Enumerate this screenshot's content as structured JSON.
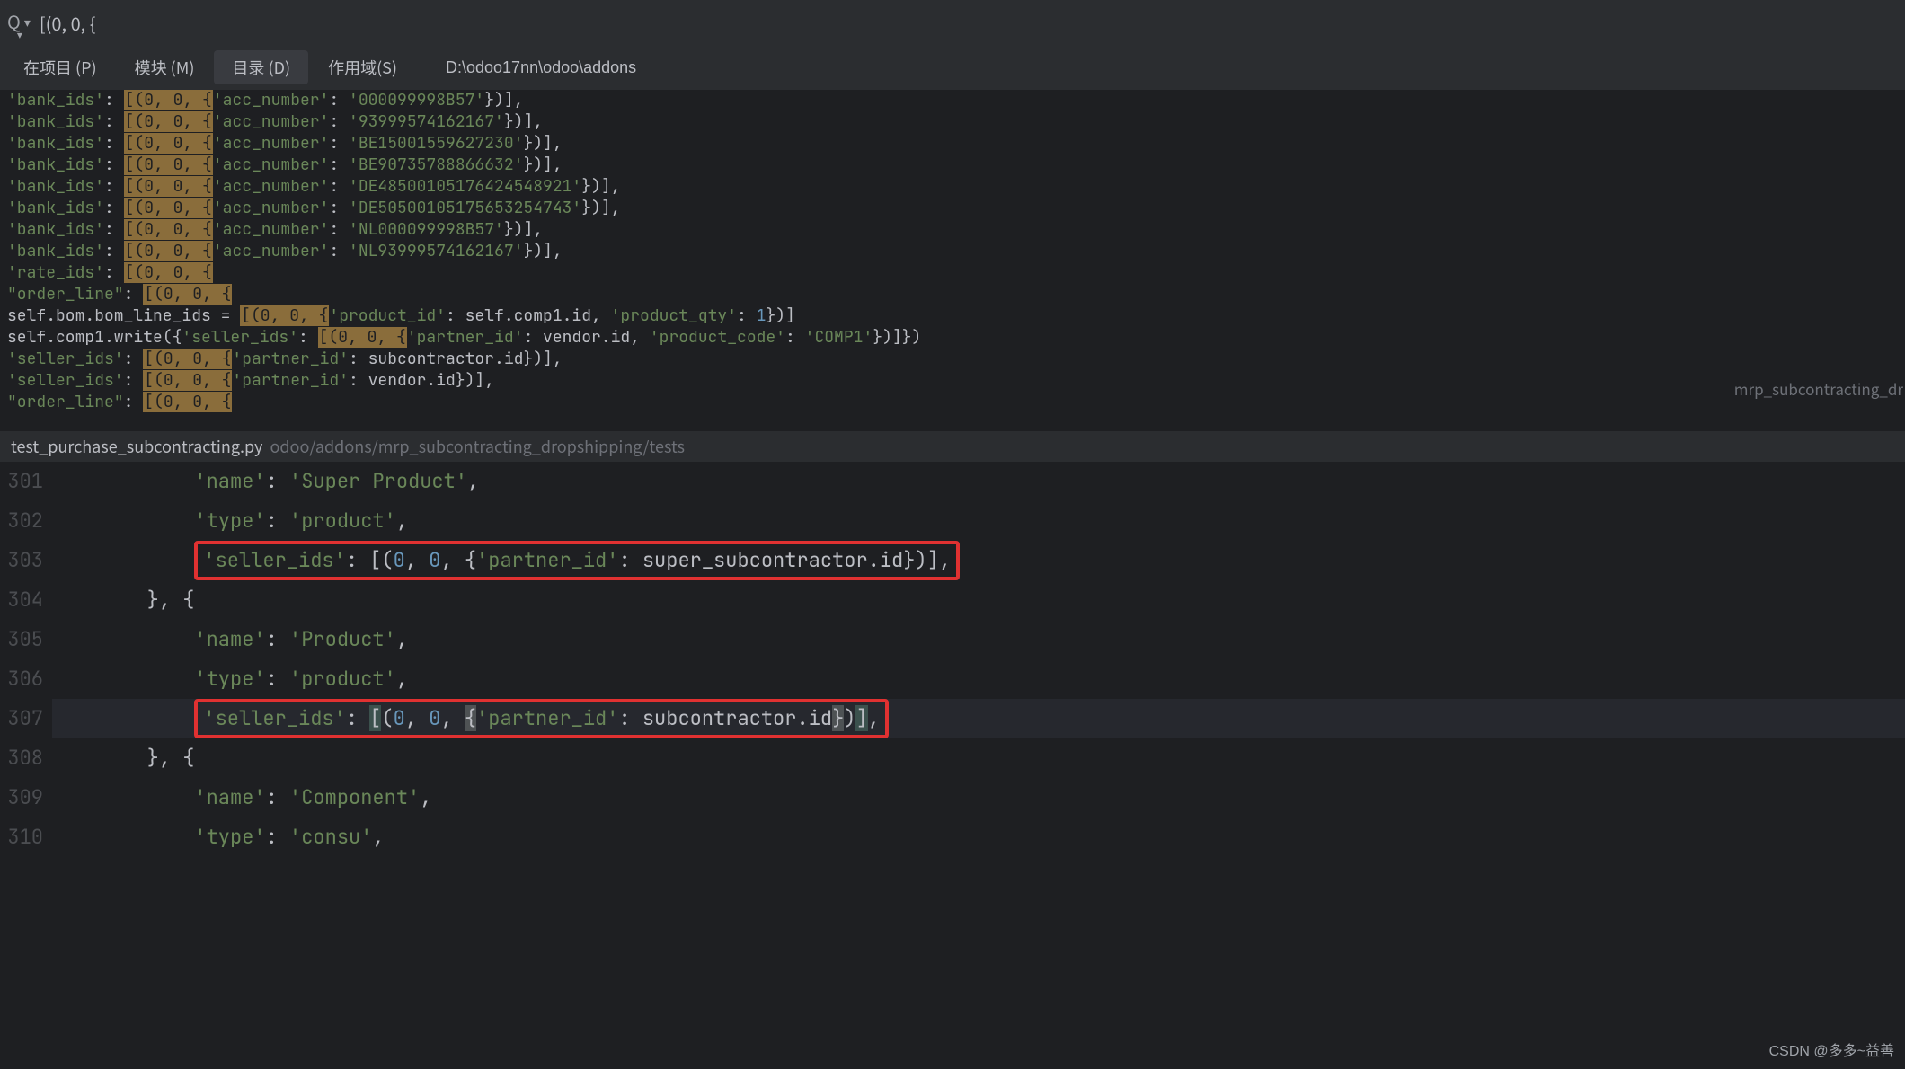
{
  "search": {
    "query": "[(0, 0, {"
  },
  "scopes": {
    "tabs": [
      {
        "label": "在项目 (",
        "key": "P",
        "suffix": ")"
      },
      {
        "label": "模块 (",
        "key": "M",
        "suffix": ")"
      },
      {
        "label": "目录 (",
        "key": "D",
        "suffix": ")"
      },
      {
        "label": "作用域(",
        "key": "S",
        "suffix": ")"
      }
    ],
    "activeIndex": 2,
    "path": "D:\\odoo17nn\\odoo\\addons"
  },
  "results": {
    "hint": "mrp_subcontracting_dr",
    "rows": [
      {
        "pre": "'bank_ids': ",
        "hl": "[(0, 0, {",
        "post": "'acc_number': '000099998B57'})],"
      },
      {
        "pre": "'bank_ids': ",
        "hl": "[(0, 0, {",
        "post": "'acc_number': '93999574162167'})],"
      },
      {
        "pre": "'bank_ids': ",
        "hl": "[(0, 0, {",
        "post": "'acc_number': 'BE15001559627230'})],"
      },
      {
        "pre": "'bank_ids': ",
        "hl": "[(0, 0, {",
        "post": "'acc_number': 'BE90735788866632'})],"
      },
      {
        "pre": "'bank_ids': ",
        "hl": "[(0, 0, {",
        "post": "'acc_number': 'DE48500105176424548921'})],"
      },
      {
        "pre": "'bank_ids': ",
        "hl": "[(0, 0, {",
        "post": "'acc_number': 'DE50500105175653254743'})],"
      },
      {
        "pre": "'bank_ids': ",
        "hl": "[(0, 0, {",
        "post": "'acc_number': 'NL000099998B57'})],"
      },
      {
        "pre": "'bank_ids': ",
        "hl": "[(0, 0, {",
        "post": "'acc_number': 'NL93999574162167'})],"
      },
      {
        "pre": "'rate_ids': ",
        "hl": "[(0, 0, {",
        "post": ""
      },
      {
        "pre": "\"order_line\": ",
        "hl": "[(0, 0, {",
        "post": ""
      },
      {
        "pre": "self.bom.bom_line_ids = ",
        "hl": "[(0, 0, {",
        "post": "'product_id': self.comp1.id, 'product_qty': 1})]"
      },
      {
        "pre": "self.comp1.write({'seller_ids': ",
        "hl": "[(0, 0, {",
        "post": "'partner_id': vendor.id, 'product_code': 'COMP1'})]})"
      },
      {
        "pre": "'seller_ids': ",
        "hl": "[(0, 0, {",
        "post": "'partner_id': subcontractor.id})],"
      },
      {
        "pre": "'seller_ids': ",
        "hl": "[(0, 0, {",
        "post": "'partner_id': vendor.id})],"
      },
      {
        "pre": "\"order_line\": ",
        "hl": "[(0, 0, {",
        "post": ""
      }
    ]
  },
  "pathbar": {
    "filename": "test_purchase_subcontracting.py",
    "filepath": "odoo/addons/mrp_subcontracting_dropshipping/tests"
  },
  "editor": {
    "startLine": 301,
    "lines": [
      {
        "n": 301,
        "indent": "            ",
        "tokens": [
          {
            "t": "mstr",
            "v": "'name'"
          },
          {
            "t": "sym",
            "v": ": "
          },
          {
            "t": "mstr",
            "v": "'Super Product'"
          },
          {
            "t": "sym",
            "v": ","
          }
        ]
      },
      {
        "n": 302,
        "indent": "            ",
        "tokens": [
          {
            "t": "mstr",
            "v": "'type'"
          },
          {
            "t": "sym",
            "v": ": "
          },
          {
            "t": "mstr",
            "v": "'product'"
          },
          {
            "t": "sym",
            "v": ","
          }
        ]
      },
      {
        "n": 303,
        "indent": "            ",
        "box": true,
        "tokens": [
          {
            "t": "mstr",
            "v": "'seller_ids'"
          },
          {
            "t": "sym",
            "v": ": [("
          },
          {
            "t": "mnum",
            "v": "0"
          },
          {
            "t": "sym",
            "v": ", "
          },
          {
            "t": "mnum",
            "v": "0"
          },
          {
            "t": "sym",
            "v": ", {"
          },
          {
            "t": "mstr",
            "v": "'partner_id'"
          },
          {
            "t": "sym",
            "v": ": super_subcontractor.id})],"
          }
        ]
      },
      {
        "n": 304,
        "indent": "        ",
        "tokens": [
          {
            "t": "sym",
            "v": "}, {"
          }
        ]
      },
      {
        "n": 305,
        "indent": "            ",
        "tokens": [
          {
            "t": "mstr",
            "v": "'name'"
          },
          {
            "t": "sym",
            "v": ": "
          },
          {
            "t": "mstr",
            "v": "'Product'"
          },
          {
            "t": "sym",
            "v": ","
          }
        ]
      },
      {
        "n": 306,
        "indent": "            ",
        "tokens": [
          {
            "t": "mstr",
            "v": "'type'"
          },
          {
            "t": "sym",
            "v": ": "
          },
          {
            "t": "mstr",
            "v": "'product'"
          },
          {
            "t": "sym",
            "v": ","
          }
        ]
      },
      {
        "n": 307,
        "current": true,
        "indent": "            ",
        "box": true,
        "tokens": [
          {
            "t": "mstr",
            "v": "'seller_ids'"
          },
          {
            "t": "sym",
            "v": ": "
          },
          {
            "t": "brmatch",
            "v": "["
          },
          {
            "t": "sym",
            "v": "("
          },
          {
            "t": "mnum",
            "v": "0"
          },
          {
            "t": "sym",
            "v": ", "
          },
          {
            "t": "mnum",
            "v": "0"
          },
          {
            "t": "sym",
            "v": ", "
          },
          {
            "t": "brmatch2",
            "v": "{"
          },
          {
            "t": "mstr",
            "v": "'partner_id'"
          },
          {
            "t": "sym",
            "v": ": subcontractor.id"
          },
          {
            "t": "brmatch2",
            "v": "}"
          },
          {
            "t": "sym",
            "v": ")"
          },
          {
            "t": "brmatch",
            "v": "]"
          },
          {
            "t": "sym",
            "v": ","
          }
        ]
      },
      {
        "n": 308,
        "indent": "        ",
        "tokens": [
          {
            "t": "sym",
            "v": "}, {"
          }
        ]
      },
      {
        "n": 309,
        "indent": "            ",
        "tokens": [
          {
            "t": "mstr",
            "v": "'name'"
          },
          {
            "t": "sym",
            "v": ": "
          },
          {
            "t": "mstr",
            "v": "'Component'"
          },
          {
            "t": "sym",
            "v": ","
          }
        ]
      },
      {
        "n": 310,
        "indent": "            ",
        "tokens": [
          {
            "t": "mstr",
            "v": "'type'"
          },
          {
            "t": "sym",
            "v": ": "
          },
          {
            "t": "mstr",
            "v": "'consu'"
          },
          {
            "t": "sym",
            "v": ","
          }
        ]
      }
    ]
  },
  "watermark": "CSDN @多多~益善"
}
